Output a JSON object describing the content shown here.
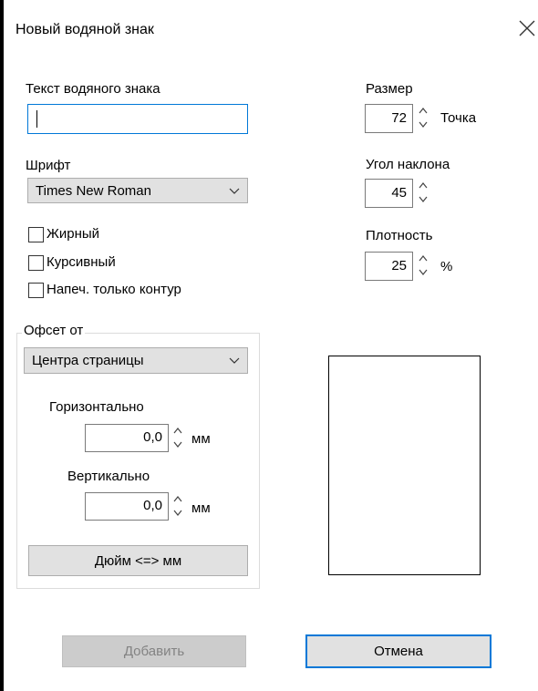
{
  "dialog": {
    "title": "Новый водяной знак"
  },
  "watermark_text": {
    "label": "Текст водяного знака",
    "value": ""
  },
  "font": {
    "label": "Шрифт",
    "selected": "Times New Roman"
  },
  "style": {
    "bold_label": "Жирный",
    "italic_label": "Курсивный",
    "outline_label": "Напеч. только контур"
  },
  "offset": {
    "legend": "Офсет от",
    "selected": "Центра страницы",
    "horizontal_label": "Горизонтально",
    "horizontal_value": "0,0",
    "horizontal_unit": "мм",
    "vertical_label": "Вертикально",
    "vertical_value": "0,0",
    "vertical_unit": "мм",
    "toggle_units_label": "Дюйм <=> мм"
  },
  "size": {
    "label": "Размер",
    "value": "72",
    "unit": "Точка"
  },
  "angle": {
    "label": "Угол наклона",
    "value": "45"
  },
  "density": {
    "label": "Плотность",
    "value": "25",
    "unit": "%"
  },
  "buttons": {
    "add_label": "Добавить",
    "cancel_label": "Отмена"
  },
  "colors": {
    "accent": "#0078d7",
    "button_face": "#e1e1e1",
    "disabled_text": "#838383"
  }
}
